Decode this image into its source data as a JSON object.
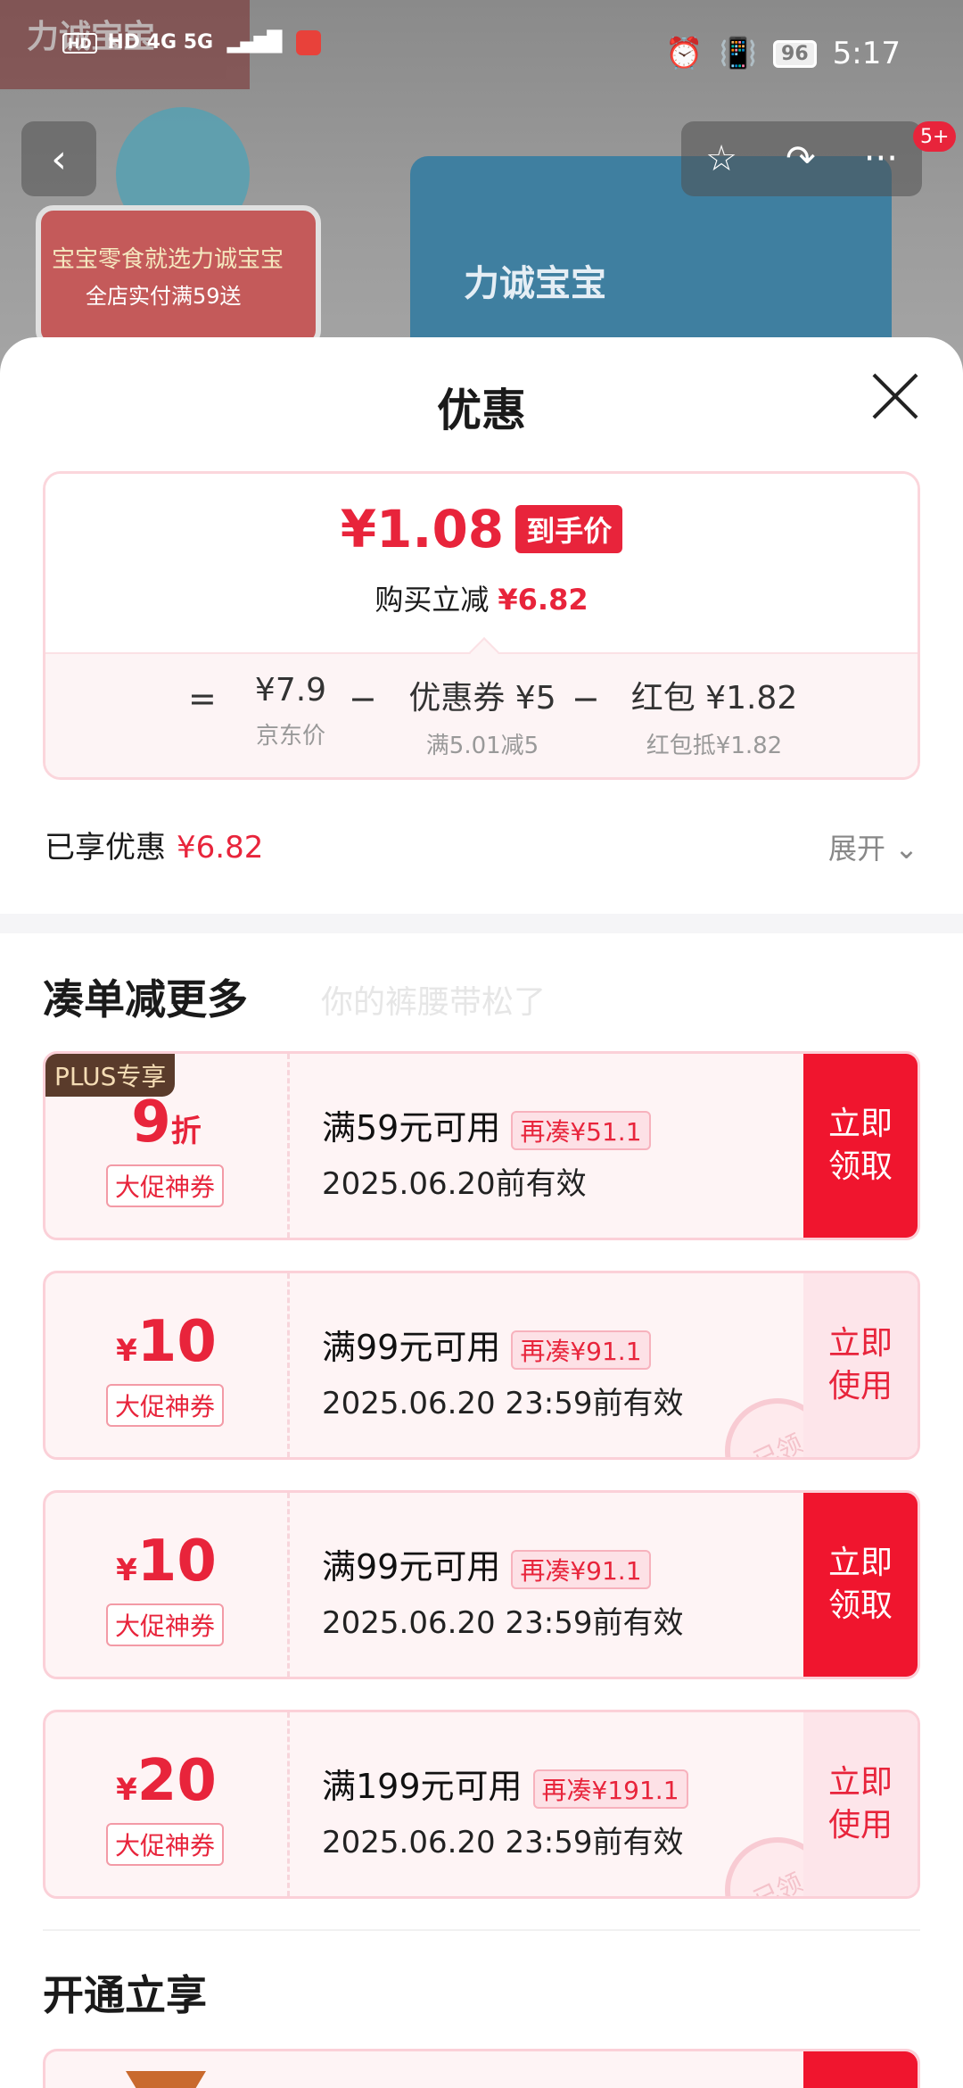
{
  "status": {
    "left": "HD 4G 5G",
    "time": "5:17",
    "battery": "96"
  },
  "nav": {
    "back": "‹",
    "star": "☆",
    "share": "↷",
    "more": "···",
    "badge": "5+"
  },
  "backdrop": {
    "brand": "力诚宝宝",
    "banner_line1": "宝宝零食就选力诚宝宝",
    "banner_line2": "全店实付满59送",
    "pack_label": "力诚宝宝"
  },
  "sheet": {
    "title": "优惠"
  },
  "price": {
    "final": "¥1.08",
    "final_tag": "到手价",
    "reduce_label": "购买立减",
    "reduce_amount": "¥6.82",
    "eq": "=",
    "minus": "−",
    "jd_value": "¥7.9",
    "jd_label": "京东价",
    "coupon_value": "优惠券 ¥5",
    "coupon_label": "满5.01减5",
    "redpack_value": "红包 ¥1.82",
    "redpack_label": "红包抵¥1.82"
  },
  "enjoy": {
    "label": "已享优惠",
    "amount": "¥6.82",
    "expand": "展开 ⌄"
  },
  "section1": {
    "title": "凑单减更多",
    "watermark": "你的裤腰带松了"
  },
  "coupons": [
    {
      "badge": "PLUS专享",
      "amount_big": "9",
      "amount_small": "折",
      "tag": "大促神券",
      "condition": "满59元可用",
      "gap": "再凑¥51.1",
      "date": "2025.06.20前有效",
      "button": "立即\n领取"
    },
    {
      "amount_small": "¥",
      "amount_big": "10",
      "tag": "大促神券",
      "condition": "满99元可用",
      "gap": "再凑¥91.1",
      "date": "2025.06.20 23:59前有效",
      "button": "立即\n使用",
      "stamp": "已领"
    },
    {
      "amount_small": "¥",
      "amount_big": "10",
      "tag": "大促神券",
      "condition": "满99元可用",
      "gap": "再凑¥91.1",
      "date": "2025.06.20 23:59前有效",
      "button": "立即\n领取"
    },
    {
      "amount_small": "¥",
      "amount_big": "20",
      "tag": "大促神券",
      "condition": "满199元可用",
      "gap": "再凑¥191.1",
      "date": "2025.06.20 23:59前有效",
      "button": "立即\n使用",
      "stamp": "已领"
    }
  ],
  "section2": {
    "title": "开通立享"
  }
}
